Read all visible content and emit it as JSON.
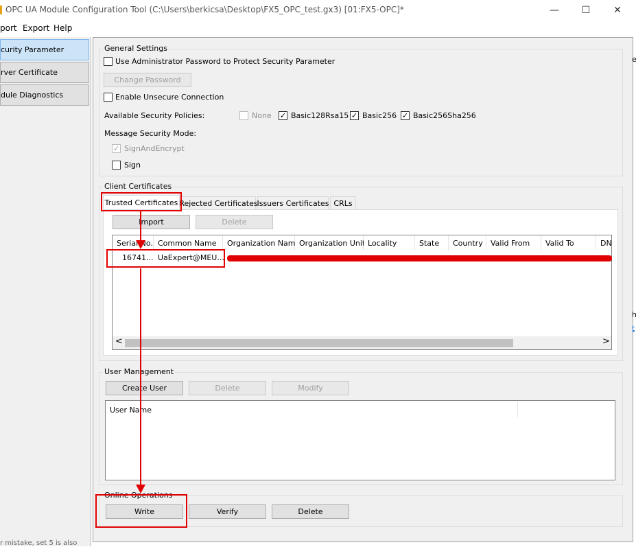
{
  "window": {
    "title": "OPC UA Module Configuration Tool (C:\\Users\\berkicsa\\Desktop\\FX5_OPC_test.gx3) [01:FX5-OPC]*",
    "minimize": "—",
    "maximize": "☐",
    "close": "✕"
  },
  "menu": {
    "items": [
      "port",
      "Export",
      "Help"
    ]
  },
  "nav": {
    "items": [
      "curity Parameter",
      "rver Certificate",
      "dule Diagnostics"
    ]
  },
  "general": {
    "title": "General Settings",
    "use_admin_pw": "Use Administrator Password to Protect Security Parameter",
    "change_password": "Change Password",
    "enable_unsecure": "Enable Unsecure Connection",
    "available_policies": "Available Security Policies:",
    "policies": [
      {
        "label": "None",
        "checked": false,
        "enabled": false
      },
      {
        "label": "Basic128Rsa15",
        "checked": true,
        "enabled": true
      },
      {
        "label": "Basic256",
        "checked": true,
        "enabled": true
      },
      {
        "label": "Basic256Sha256",
        "checked": true,
        "enabled": true
      }
    ],
    "message_mode": "Message Security Mode:",
    "sign_encrypt": "SignAndEncrypt",
    "sign": "Sign"
  },
  "client_certs": {
    "title": "Client Certificates",
    "tabs": [
      "Trusted Certificates",
      "Rejected Certificates",
      "Issuers Certificates",
      "CRLs"
    ],
    "import": "Import",
    "delete": "Delete",
    "columns": [
      "Serial No.",
      "Common Name",
      "Organization Name",
      "Organization Unit",
      "Locality",
      "State",
      "Country",
      "Valid From",
      "Valid To",
      "DN"
    ],
    "rows": [
      {
        "serial": "16741...",
        "common_name": "UaExpert@MEU..."
      }
    ],
    "scroll_left": "<",
    "scroll_right": ">"
  },
  "user_mgmt": {
    "title": "User Management",
    "create_user": "Create User",
    "delete": "Delete",
    "modify": "Modify",
    "col_user_name": "User Name"
  },
  "online_ops": {
    "title": "Online Operations",
    "write": "Write",
    "verify": "Verify",
    "delete": "Delete"
  },
  "footer_fragment": "r mistake, set 5 is also",
  "right_fragments": [
    "e",
    "h",
    "t"
  ],
  "colors": {
    "annotation_red": "#e00000",
    "nav_active": "#cce4f7"
  }
}
